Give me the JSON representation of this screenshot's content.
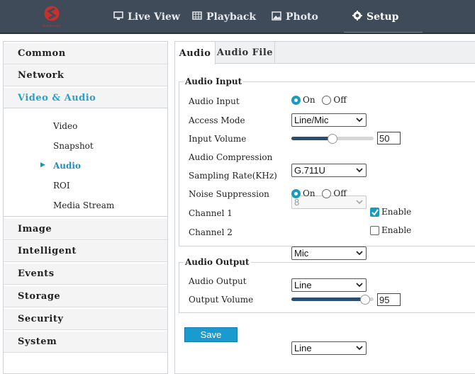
{
  "header": {
    "logo_text": "Grandstream",
    "brand_color": "#c9302c",
    "accent_color": "#28a6cf",
    "tabs": [
      {
        "label": "Live View",
        "icon": "monitor-icon"
      },
      {
        "label": "Playback",
        "icon": "film-icon"
      },
      {
        "label": "Photo",
        "icon": "image-icon"
      },
      {
        "label": "Setup",
        "icon": "gear-icon",
        "active": true
      }
    ]
  },
  "sidebar": {
    "items": [
      {
        "label": "Common"
      },
      {
        "label": "Network"
      },
      {
        "label": "Video & Audio",
        "open": true
      },
      {
        "label": "Image"
      },
      {
        "label": "Intelligent"
      },
      {
        "label": "Events"
      },
      {
        "label": "Storage"
      },
      {
        "label": "Security"
      },
      {
        "label": "System"
      }
    ],
    "subitems": [
      {
        "label": "Video"
      },
      {
        "label": "Snapshot"
      },
      {
        "label": "Audio",
        "active": true
      },
      {
        "label": "ROI"
      },
      {
        "label": "Media Stream"
      }
    ]
  },
  "main": {
    "tabs": [
      {
        "label": "Audio",
        "active": true
      },
      {
        "label": "Audio File"
      }
    ],
    "audio_input": {
      "legend": "Audio Input",
      "audio_input_label": "Audio Input",
      "on_label": "On",
      "off_label": "Off",
      "audio_input_value": "On",
      "access_mode_label": "Access Mode",
      "access_mode_value": "Line/Mic",
      "input_volume_label": "Input Volume",
      "input_volume_value": "50",
      "input_volume_fraction": 0.5,
      "compression_label": "Audio Compression",
      "compression_value": "G.711U",
      "sampling_label": "Sampling Rate(KHz)",
      "sampling_value": "8",
      "noise_label": "Noise Suppression",
      "noise_value": "On",
      "channel1_label": "Channel 1",
      "channel1_value": "Mic",
      "channel1_enable": true,
      "channel2_label": "Channel 2",
      "channel2_value": "Line",
      "channel2_enable": false,
      "enable_label": "Enable"
    },
    "audio_output": {
      "legend": "Audio Output",
      "audio_output_label": "Audio Output",
      "audio_output_value": "Line",
      "output_volume_label": "Output Volume",
      "output_volume_value": "95",
      "output_volume_fraction": 0.95
    },
    "save_label": "Save"
  }
}
